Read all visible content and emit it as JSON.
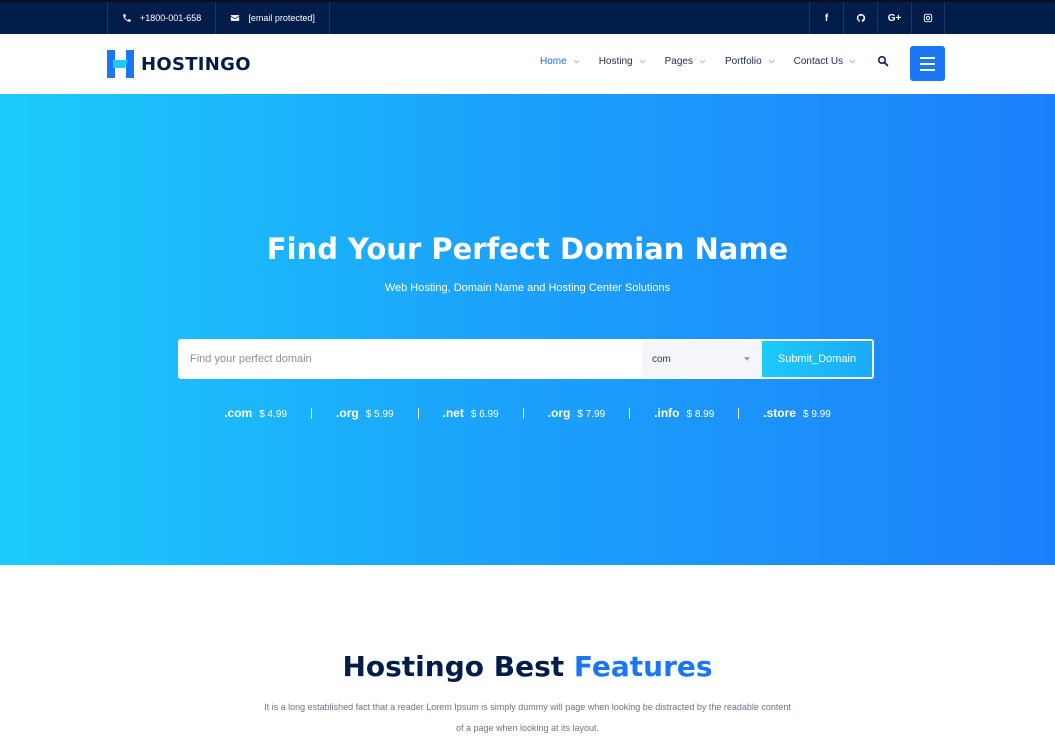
{
  "topbar": {
    "phone": "+1800-001-658",
    "email": "[email protected]",
    "social": [
      {
        "icon": "facebook-icon",
        "label": "f"
      },
      {
        "icon": "github-icon",
        "label": ""
      },
      {
        "icon": "google-plus-icon",
        "label": "G+"
      },
      {
        "icon": "instagram-icon",
        "label": ""
      }
    ]
  },
  "header": {
    "logo_text": "HOSTINGO",
    "nav": [
      {
        "label": "Home",
        "active": true
      },
      {
        "label": "Hosting"
      },
      {
        "label": "Pages"
      },
      {
        "label": "Portfolio"
      },
      {
        "label": "Contact Us"
      }
    ]
  },
  "hero": {
    "title": "Find Your Perfect Domian Name",
    "subtitle": "Web Hosting, Domain Name and Hosting Center Solutions",
    "search_placeholder": "Find your perfect domain",
    "tld_selected": "com",
    "submit_label": "Submit_Domain",
    "prices": [
      {
        "ext": ".com",
        "price": "$ 4.99"
      },
      {
        "ext": ".org",
        "price": "$ 5.99"
      },
      {
        "ext": ".net",
        "price": "$ 6.99"
      },
      {
        "ext": ".org",
        "price": "$ 7.99"
      },
      {
        "ext": ".info",
        "price": "$ 8.99"
      },
      {
        "ext": ".store",
        "price": "$ 9.99"
      }
    ]
  },
  "features": {
    "title_part1": "Hostingo Best",
    "title_part2": "Features",
    "description": "It is a long established fact that a reader Lorem Ipsum is simply dummy will page when looking be distracted by the readable content of a page when looking at its layout."
  },
  "colors": {
    "topbar_bg": "#021d49",
    "accent": "#1a76f5",
    "hero_gradient_start": "#1ccbfb",
    "hero_gradient_end": "#1d80fb"
  }
}
